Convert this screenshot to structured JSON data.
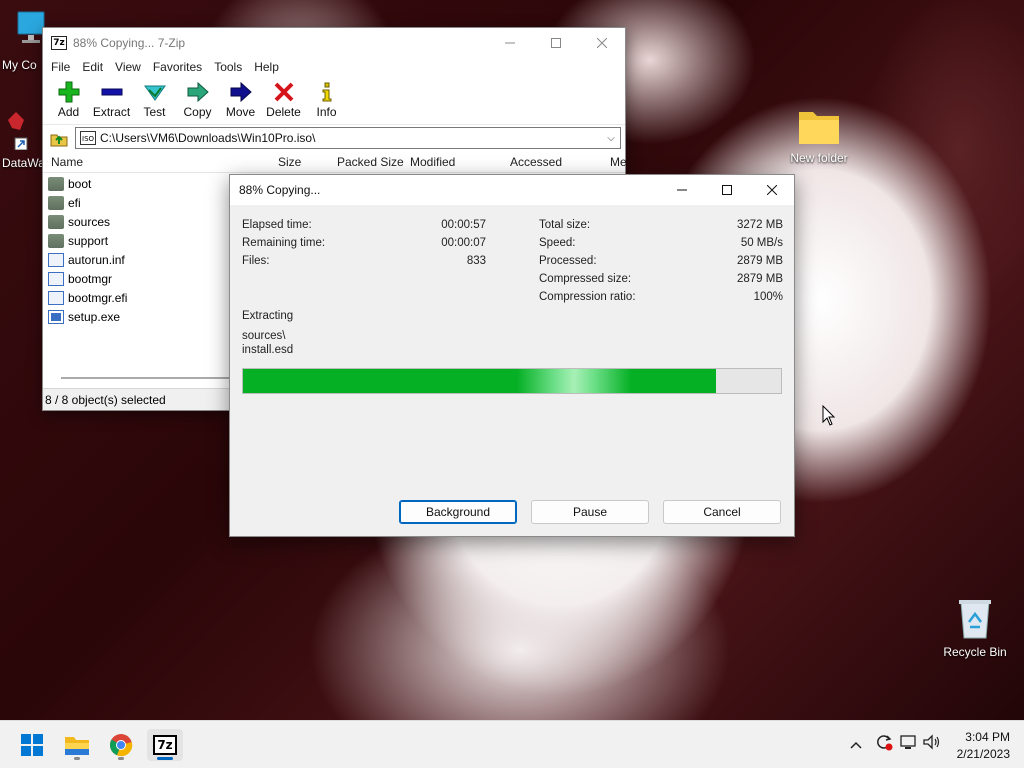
{
  "desktop": {
    "icons": {
      "my_computer": "My Co",
      "datawarrior": "DataWa",
      "new_folder": "New folder",
      "recycle_bin": "Recycle Bin"
    }
  },
  "main_window": {
    "title": "88% Copying... 7-Zip",
    "app_icon_text": "7z",
    "menu": [
      "File",
      "Edit",
      "View",
      "Favorites",
      "Tools",
      "Help"
    ],
    "toolbar": {
      "add": "Add",
      "extract": "Extract",
      "test": "Test",
      "copy": "Copy",
      "move": "Move",
      "delete": "Delete",
      "info": "Info"
    },
    "address": "C:\\Users\\VM6\\Downloads\\Win10Pro.iso\\",
    "columns": [
      "Name",
      "Size",
      "Packed Size",
      "Modified",
      "Accessed",
      "Me"
    ],
    "files": [
      {
        "name": "boot",
        "type": "folder"
      },
      {
        "name": "efi",
        "type": "folder"
      },
      {
        "name": "sources",
        "type": "folder"
      },
      {
        "name": "support",
        "type": "folder"
      },
      {
        "name": "autorun.inf",
        "type": "file"
      },
      {
        "name": "bootmgr",
        "type": "file"
      },
      {
        "name": "bootmgr.efi",
        "type": "file"
      },
      {
        "name": "setup.exe",
        "type": "exe"
      }
    ],
    "status": "8 / 8 object(s) selected"
  },
  "dialog": {
    "title": "88% Copying...",
    "left_stats": [
      {
        "label": "Elapsed time:",
        "value": "00:00:57"
      },
      {
        "label": "Remaining time:",
        "value": "00:00:07"
      },
      {
        "label": "Files:",
        "value": "833"
      }
    ],
    "right_stats": [
      {
        "label": "Total size:",
        "value": "3272 MB"
      },
      {
        "label": "Speed:",
        "value": "50 MB/s"
      },
      {
        "label": "Processed:",
        "value": "2879 MB"
      },
      {
        "label": "Compressed size:",
        "value": "2879 MB"
      },
      {
        "label": "Compression ratio:",
        "value": "100%"
      }
    ],
    "operation": "Extracting",
    "current_path": "sources\\",
    "current_file": "install.esd",
    "progress_fraction": 0.88,
    "buttons": {
      "background": "Background",
      "pause": "Pause",
      "cancel": "Cancel"
    }
  },
  "taskbar": {
    "apps": [
      "start-icon",
      "file-explorer-icon",
      "chrome-icon",
      "7zip-icon"
    ],
    "seven_zip_label": "7z",
    "time": "3:04 PM",
    "date": "2/21/2023"
  },
  "colors": {
    "progress": "#06b025",
    "accent": "#0067c0"
  }
}
